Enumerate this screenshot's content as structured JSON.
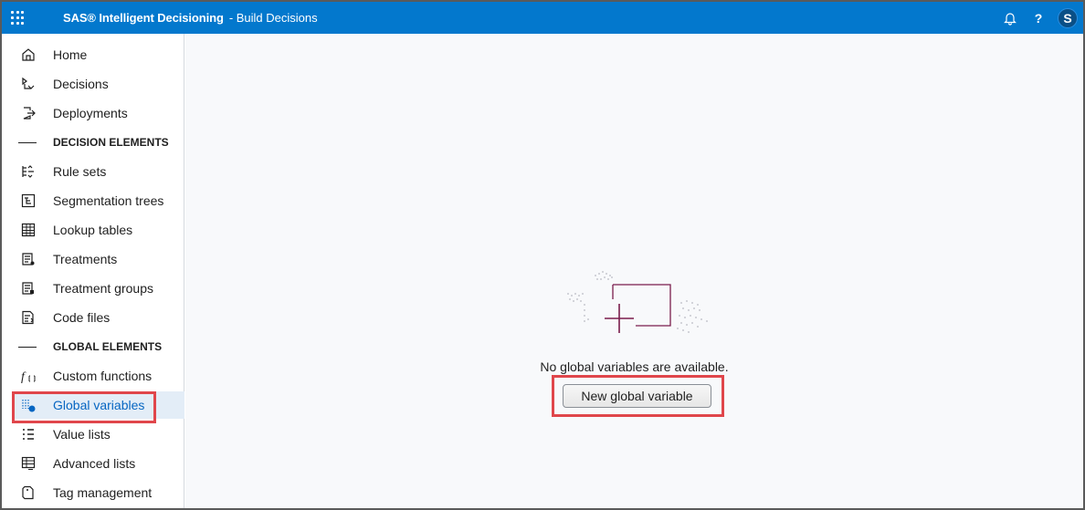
{
  "header": {
    "app_name": "SAS® Intelligent Decisioning",
    "page_name": "- Build Decisions",
    "help_label": "?",
    "avatar_initial": "S",
    "bar_color": "#0378cd"
  },
  "sidebar": {
    "items": [
      {
        "label": "Home",
        "icon": "home-icon"
      },
      {
        "label": "Decisions",
        "icon": "decisions-icon"
      },
      {
        "label": "Deployments",
        "icon": "deployments-icon"
      },
      {
        "label": "DECISION ELEMENTS",
        "section": true
      },
      {
        "label": "Rule sets",
        "icon": "rule-sets-icon"
      },
      {
        "label": "Segmentation trees",
        "icon": "segmentation-trees-icon"
      },
      {
        "label": "Lookup tables",
        "icon": "lookup-tables-icon"
      },
      {
        "label": "Treatments",
        "icon": "treatments-icon"
      },
      {
        "label": "Treatment groups",
        "icon": "treatment-groups-icon"
      },
      {
        "label": "Code files",
        "icon": "code-files-icon"
      },
      {
        "label": "GLOBAL ELEMENTS",
        "section": true
      },
      {
        "label": "Custom functions",
        "icon": "custom-functions-icon"
      },
      {
        "label": "Global variables",
        "icon": "global-variables-icon",
        "active": true
      },
      {
        "label": "Value lists",
        "icon": "value-lists-icon"
      },
      {
        "label": "Advanced lists",
        "icon": "advanced-lists-icon"
      },
      {
        "label": "Tag management",
        "icon": "tag-management-icon"
      }
    ],
    "active_color": "#0766c2"
  },
  "main": {
    "empty_message": "No global variables are available.",
    "new_button_label": "New global variable"
  },
  "annotations": {
    "highlight_color": "#e0464b"
  }
}
